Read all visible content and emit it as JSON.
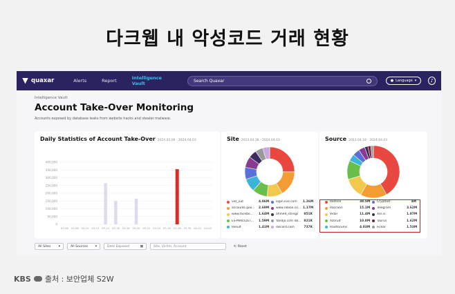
{
  "headline": "다크웹 내 악성코드 거래 현황",
  "app": {
    "logo": "quaxar",
    "nav": [
      "Alerts",
      "Report",
      "Intelligence Vault"
    ],
    "search_placeholder": "Search Quaxar",
    "language": "Language",
    "breadcrumb": "Intelligence Vault",
    "title": "Account Take-Over Monitoring",
    "subtitle": "Accounts exposed by database leaks from website hacks and stealer malware."
  },
  "daily": {
    "title": "Daily Statistics of Account Take-Over",
    "date_range": "2024.03.06 - 2024.04.03"
  },
  "site": {
    "title": "Site",
    "date_range": "2013.04.18 - 2024.04.03",
    "legend": [
      {
        "name": "vez_out",
        "value": "4.06M",
        "color": "#e8483f"
      },
      {
        "name": "login.live.com",
        "value": "1.26M",
        "color": "#5a6fd8"
      },
      {
        "name": "accounts.goo...",
        "value": "2.69M",
        "color": "#f39c33"
      },
      {
        "name": "www.roblox.co...",
        "value": "1.17M",
        "color": "#8a3b8f"
      },
      {
        "name": "www.facebo...",
        "value": "1.64M",
        "color": "#f2c94c"
      },
      {
        "name": "ahmed_strings",
        "value": "851K",
        "color": "#3a2d5c"
      },
      {
        "name": "ES-MAILYZET...",
        "value": "1.59M",
        "color": "#6abf4b"
      },
      {
        "name": "Yandja.com 48...",
        "value": "821K",
        "color": "#9a9a9a"
      },
      {
        "name": "Result",
        "value": "1.41M",
        "color": "#3ab4d9"
      },
      {
        "name": "discord.com",
        "value": "737K",
        "color": "#c9a8e0"
      }
    ]
  },
  "source": {
    "title": "Source",
    "date_range": "2013.04.18 - 2024.04.03",
    "legend": [
      {
        "name": "Redline",
        "value": "38.5M",
        "color": "#e8483f"
      },
      {
        "name": "Cryptbot",
        "value": "4M",
        "color": "#5a6fd8"
      },
      {
        "name": "Raccoon",
        "value": "15.1M",
        "color": "#f39c33"
      },
      {
        "name": "Telegram",
        "value": "3.62M",
        "color": "#8a3b8f"
      },
      {
        "name": "Vidar",
        "value": "11.4M",
        "color": "#f2c94c"
      },
      {
        "name": "Xss.is",
        "value": "1.87M",
        "color": "#3a2d5c"
      },
      {
        "name": "Azorult",
        "value": "10.8M",
        "color": "#6abf4b"
      },
      {
        "name": "Taurus",
        "value": "1.62M",
        "color": "#7a2030"
      },
      {
        "name": "Raidforums",
        "value": "4.03M",
        "color": "#3ab4d9"
      },
      {
        "name": "Fickar",
        "value": "1.53M",
        "color": "#9a9a9a"
      }
    ]
  },
  "filters": {
    "sites": "All Sites",
    "sources": "All Sources",
    "date": "Date Exposed",
    "search_placeholder": "Site, Victim, Account",
    "reset": "Reset"
  },
  "source_credit": {
    "broadcaster": "KBS",
    "text": "출처 : 보안업체 S2W"
  },
  "chart_data": [
    {
      "type": "bar",
      "title": "Daily Statistics of Account Take-Over",
      "categories": [
        "03-06",
        "03-08",
        "03-10",
        "03-12",
        "03-14",
        "03-16",
        "03-18",
        "03-20",
        "03-22",
        "03-24",
        "03-26",
        "03-28",
        "03-30",
        "04-01",
        "04-03"
      ],
      "values": [
        0,
        0,
        0,
        0,
        265000,
        150000,
        0,
        165000,
        0,
        0,
        0,
        355000,
        0,
        0,
        0
      ],
      "highlight_index": 11,
      "highlight_color": "#d62f26",
      "bar_color": "#dcdcec",
      "yticks": [
        "400,000",
        "350,000",
        "300,000",
        "250,000",
        "200,000",
        "150,000",
        "100,000",
        "50,000",
        "0"
      ],
      "ylim": [
        0,
        400000
      ]
    },
    {
      "type": "pie",
      "title": "Site",
      "labels": [
        "vez_out",
        "accounts.goo...",
        "www.facebo...",
        "ES-MAILYZET...",
        "Result",
        "login.live.com",
        "www.roblox.co...",
        "ahmed_strings",
        "Yandja.com 48...",
        "discord.com"
      ],
      "values": [
        4.06,
        2.69,
        1.64,
        1.59,
        1.41,
        1.26,
        1.17,
        0.851,
        0.821,
        0.737
      ],
      "colors": [
        "#e8483f",
        "#f39c33",
        "#f2c94c",
        "#6abf4b",
        "#3ab4d9",
        "#5a6fd8",
        "#8a3b8f",
        "#3a2d5c",
        "#9a9a9a",
        "#c9a8e0"
      ]
    },
    {
      "type": "pie",
      "title": "Source",
      "labels": [
        "Redline",
        "Raccoon",
        "Vidar",
        "Azorult",
        "Raidforums",
        "Cryptbot",
        "Telegram",
        "Xss.is",
        "Taurus",
        "Fickar"
      ],
      "values": [
        38.5,
        15.1,
        11.4,
        10.8,
        4.03,
        4.0,
        3.62,
        1.87,
        1.62,
        1.53
      ],
      "colors": [
        "#e8483f",
        "#f39c33",
        "#f2c94c",
        "#6abf4b",
        "#3ab4d9",
        "#5a6fd8",
        "#8a3b8f",
        "#3a2d5c",
        "#7a2030",
        "#9a9a9a"
      ]
    }
  ]
}
